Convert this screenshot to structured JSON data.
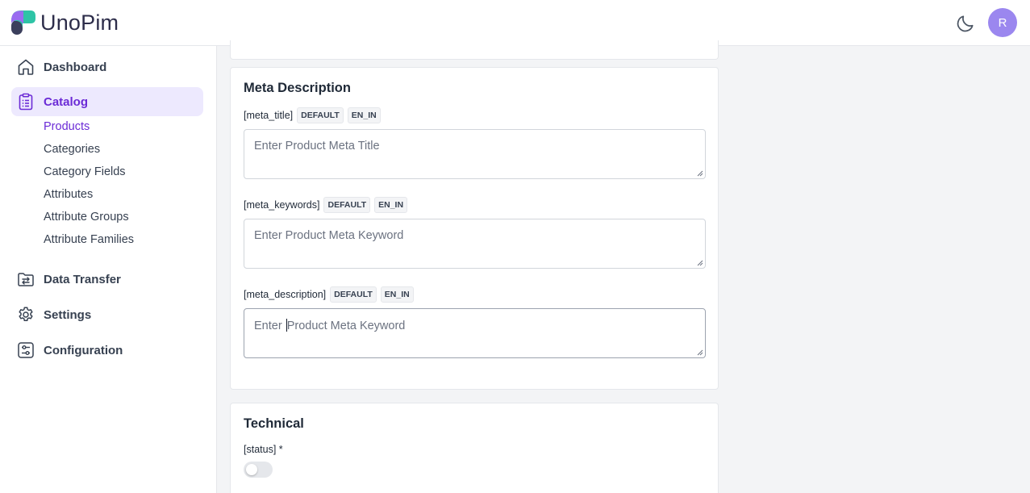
{
  "app": {
    "logo_text": "UnoPim",
    "avatar_initial": "R"
  },
  "icons": {
    "theme_toggle": "moon-icon",
    "dashboard": "home-icon",
    "catalog": "clipboard-list-icon",
    "data_transfer": "folder-transfer-icon",
    "settings": "gear-icon",
    "configuration": "sliders-icon"
  },
  "colors": {
    "accent": "#6b2bd6",
    "active_bg": "#ede9fe",
    "avatar_bg": "#9b87ef"
  },
  "sidebar": {
    "dashboard": "Dashboard",
    "catalog": "Catalog",
    "catalog_items": [
      "Products",
      "Categories",
      "Category Fields",
      "Attributes",
      "Attribute Groups",
      "Attribute Families"
    ],
    "data_transfer": "Data Transfer",
    "settings": "Settings",
    "configuration": "Configuration"
  },
  "meta_section": {
    "title": "Meta Description",
    "fields": [
      {
        "label": "[meta_title]",
        "badges": [
          "DEFAULT",
          "EN_IN"
        ],
        "placeholder": "Enter Product Meta Title",
        "value": ""
      },
      {
        "label": "[meta_keywords]",
        "badges": [
          "DEFAULT",
          "EN_IN"
        ],
        "placeholder": "Enter Product Meta Keyword",
        "value": ""
      },
      {
        "label": "[meta_description]",
        "badges": [
          "DEFAULT",
          "EN_IN"
        ],
        "placeholder_before_caret": "Enter ",
        "placeholder_after_caret": "Product Meta Keyword",
        "value": ""
      }
    ]
  },
  "technical_section": {
    "title": "Technical",
    "status_label": "[status] *",
    "status_on": false
  }
}
